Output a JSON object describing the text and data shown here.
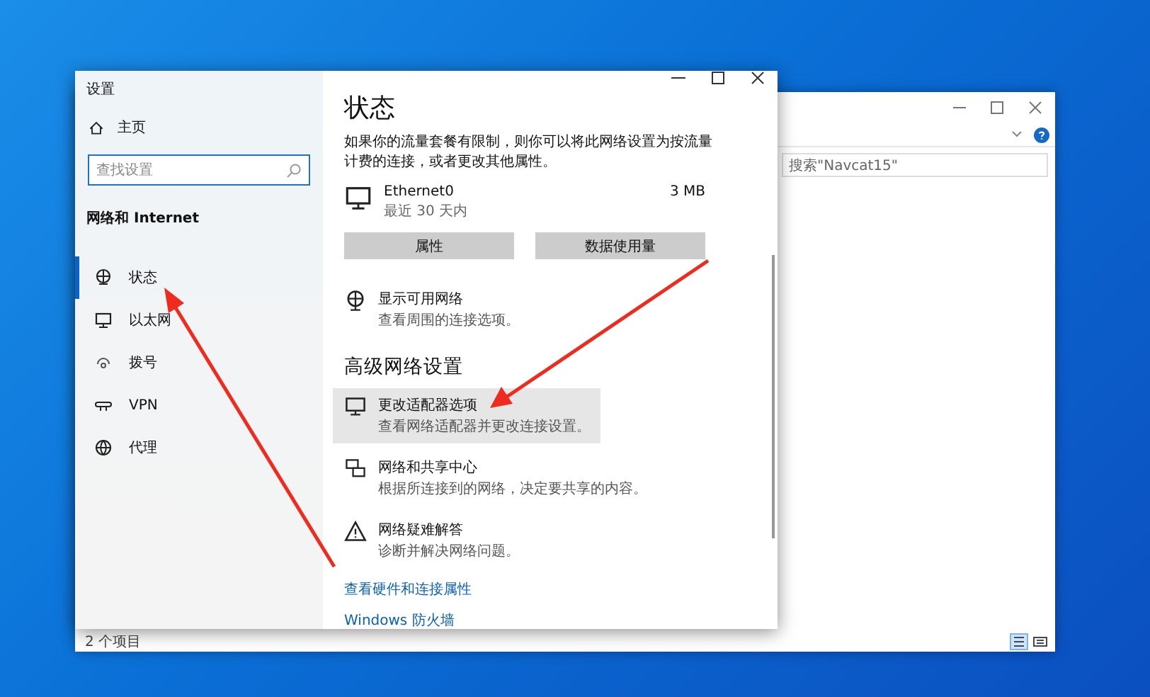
{
  "explorer": {
    "search": {
      "placeholder": "搜索\"Navcat15\""
    },
    "status": "2 个项目"
  },
  "settings": {
    "title": "设置",
    "home": "主页",
    "search": {
      "placeholder": "查找设置"
    },
    "section": "网络和 Internet",
    "nav": [
      {
        "label": "状态",
        "kind": "status",
        "selected": true
      },
      {
        "label": "以太网",
        "kind": "ethernet",
        "selected": false
      },
      {
        "label": "拨号",
        "kind": "dialup",
        "selected": false
      },
      {
        "label": "VPN",
        "kind": "vpn",
        "selected": false
      },
      {
        "label": "代理",
        "kind": "proxy",
        "selected": false
      }
    ],
    "heading": "状态",
    "intro": "如果你的流量套餐有限制，则你可以将此网络设置为按流量计费的连接，或者更改其他属性。",
    "adapter": {
      "name": "Ethernet0",
      "period": "最近 30 天内",
      "usage": "3 MB"
    },
    "buttons": [
      "属性",
      "数据使用量"
    ],
    "show_networks": {
      "title": "显示可用网络",
      "desc": "查看周围的连接选项。"
    },
    "advanced_heading": "高级网络设置",
    "advanced": [
      {
        "kind": "adapter",
        "title": "更改适配器选项",
        "desc": "查看网络适配器并更改连接设置。",
        "highlighted": true
      },
      {
        "kind": "sharing",
        "title": "网络和共享中心",
        "desc": "根据所连接到的网络，决定要共享的内容。",
        "highlighted": false
      },
      {
        "kind": "troubleshoot",
        "title": "网络疑难解答",
        "desc": "诊断并解决网络问题。",
        "highlighted": false
      }
    ],
    "links": [
      "查看硬件和连接属性",
      "Windows 防火墙"
    ]
  }
}
